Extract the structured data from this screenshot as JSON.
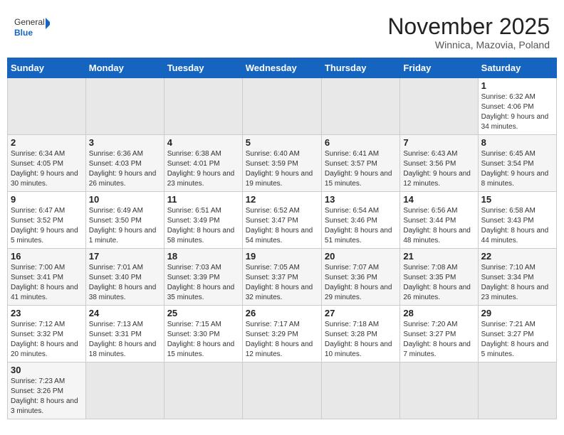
{
  "header": {
    "logo_general": "General",
    "logo_blue": "Blue",
    "month_title": "November 2025",
    "location": "Winnica, Mazovia, Poland"
  },
  "weekdays": [
    "Sunday",
    "Monday",
    "Tuesday",
    "Wednesday",
    "Thursday",
    "Friday",
    "Saturday"
  ],
  "weeks": [
    [
      {
        "day": "",
        "info": ""
      },
      {
        "day": "",
        "info": ""
      },
      {
        "day": "",
        "info": ""
      },
      {
        "day": "",
        "info": ""
      },
      {
        "day": "",
        "info": ""
      },
      {
        "day": "",
        "info": ""
      },
      {
        "day": "1",
        "info": "Sunrise: 6:32 AM\nSunset: 4:06 PM\nDaylight: 9 hours\nand 34 minutes."
      }
    ],
    [
      {
        "day": "2",
        "info": "Sunrise: 6:34 AM\nSunset: 4:05 PM\nDaylight: 9 hours\nand 30 minutes."
      },
      {
        "day": "3",
        "info": "Sunrise: 6:36 AM\nSunset: 4:03 PM\nDaylight: 9 hours\nand 26 minutes."
      },
      {
        "day": "4",
        "info": "Sunrise: 6:38 AM\nSunset: 4:01 PM\nDaylight: 9 hours\nand 23 minutes."
      },
      {
        "day": "5",
        "info": "Sunrise: 6:40 AM\nSunset: 3:59 PM\nDaylight: 9 hours\nand 19 minutes."
      },
      {
        "day": "6",
        "info": "Sunrise: 6:41 AM\nSunset: 3:57 PM\nDaylight: 9 hours\nand 15 minutes."
      },
      {
        "day": "7",
        "info": "Sunrise: 6:43 AM\nSunset: 3:56 PM\nDaylight: 9 hours\nand 12 minutes."
      },
      {
        "day": "8",
        "info": "Sunrise: 6:45 AM\nSunset: 3:54 PM\nDaylight: 9 hours\nand 8 minutes."
      }
    ],
    [
      {
        "day": "9",
        "info": "Sunrise: 6:47 AM\nSunset: 3:52 PM\nDaylight: 9 hours\nand 5 minutes."
      },
      {
        "day": "10",
        "info": "Sunrise: 6:49 AM\nSunset: 3:50 PM\nDaylight: 9 hours\nand 1 minute."
      },
      {
        "day": "11",
        "info": "Sunrise: 6:51 AM\nSunset: 3:49 PM\nDaylight: 8 hours\nand 58 minutes."
      },
      {
        "day": "12",
        "info": "Sunrise: 6:52 AM\nSunset: 3:47 PM\nDaylight: 8 hours\nand 54 minutes."
      },
      {
        "day": "13",
        "info": "Sunrise: 6:54 AM\nSunset: 3:46 PM\nDaylight: 8 hours\nand 51 minutes."
      },
      {
        "day": "14",
        "info": "Sunrise: 6:56 AM\nSunset: 3:44 PM\nDaylight: 8 hours\nand 48 minutes."
      },
      {
        "day": "15",
        "info": "Sunrise: 6:58 AM\nSunset: 3:43 PM\nDaylight: 8 hours\nand 44 minutes."
      }
    ],
    [
      {
        "day": "16",
        "info": "Sunrise: 7:00 AM\nSunset: 3:41 PM\nDaylight: 8 hours\nand 41 minutes."
      },
      {
        "day": "17",
        "info": "Sunrise: 7:01 AM\nSunset: 3:40 PM\nDaylight: 8 hours\nand 38 minutes."
      },
      {
        "day": "18",
        "info": "Sunrise: 7:03 AM\nSunset: 3:39 PM\nDaylight: 8 hours\nand 35 minutes."
      },
      {
        "day": "19",
        "info": "Sunrise: 7:05 AM\nSunset: 3:37 PM\nDaylight: 8 hours\nand 32 minutes."
      },
      {
        "day": "20",
        "info": "Sunrise: 7:07 AM\nSunset: 3:36 PM\nDaylight: 8 hours\nand 29 minutes."
      },
      {
        "day": "21",
        "info": "Sunrise: 7:08 AM\nSunset: 3:35 PM\nDaylight: 8 hours\nand 26 minutes."
      },
      {
        "day": "22",
        "info": "Sunrise: 7:10 AM\nSunset: 3:34 PM\nDaylight: 8 hours\nand 23 minutes."
      }
    ],
    [
      {
        "day": "23",
        "info": "Sunrise: 7:12 AM\nSunset: 3:32 PM\nDaylight: 8 hours\nand 20 minutes."
      },
      {
        "day": "24",
        "info": "Sunrise: 7:13 AM\nSunset: 3:31 PM\nDaylight: 8 hours\nand 18 minutes."
      },
      {
        "day": "25",
        "info": "Sunrise: 7:15 AM\nSunset: 3:30 PM\nDaylight: 8 hours\nand 15 minutes."
      },
      {
        "day": "26",
        "info": "Sunrise: 7:17 AM\nSunset: 3:29 PM\nDaylight: 8 hours\nand 12 minutes."
      },
      {
        "day": "27",
        "info": "Sunrise: 7:18 AM\nSunset: 3:28 PM\nDaylight: 8 hours\nand 10 minutes."
      },
      {
        "day": "28",
        "info": "Sunrise: 7:20 AM\nSunset: 3:27 PM\nDaylight: 8 hours\nand 7 minutes."
      },
      {
        "day": "29",
        "info": "Sunrise: 7:21 AM\nSunset: 3:27 PM\nDaylight: 8 hours\nand 5 minutes."
      }
    ],
    [
      {
        "day": "30",
        "info": "Sunrise: 7:23 AM\nSunset: 3:26 PM\nDaylight: 8 hours\nand 3 minutes."
      },
      {
        "day": "",
        "info": ""
      },
      {
        "day": "",
        "info": ""
      },
      {
        "day": "",
        "info": ""
      },
      {
        "day": "",
        "info": ""
      },
      {
        "day": "",
        "info": ""
      },
      {
        "day": "",
        "info": ""
      }
    ]
  ]
}
